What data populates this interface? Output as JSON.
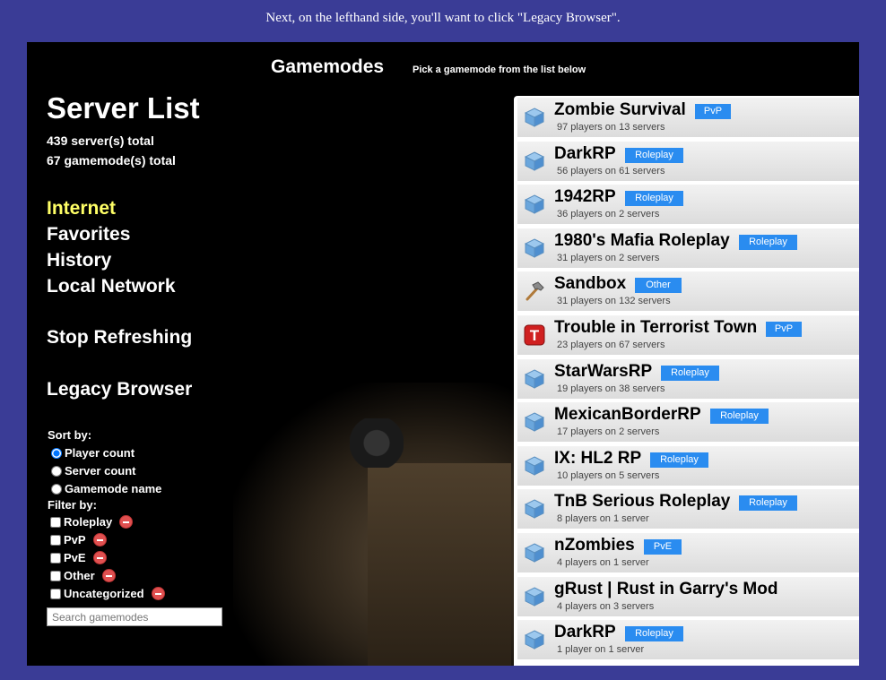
{
  "caption": "Next, on the lefthand side, you'll want to click \"Legacy Browser\".",
  "header": {
    "title": "Gamemodes",
    "subtitle": "Pick a gamemode from the list below"
  },
  "sidebar": {
    "title": "Server List",
    "servers_total": "439 server(s) total",
    "gamemodes_total": "67 gamemode(s) total",
    "nav": [
      "Internet",
      "Favorites",
      "History",
      "Local Network"
    ],
    "stop_refreshing": "Stop Refreshing",
    "legacy_browser": "Legacy Browser",
    "sort_label": "Sort by:",
    "sort_options": [
      "Player count",
      "Server count",
      "Gamemode name"
    ],
    "filter_label": "Filter by:",
    "filters": [
      "Roleplay",
      "PvP",
      "PvE",
      "Other",
      "Uncategorized"
    ],
    "search_placeholder": "Search gamemodes"
  },
  "gamemodes": [
    {
      "name": "Zombie Survival",
      "tag": "PvP",
      "stats": "97 players on 13 servers",
      "icon": "cube-icon"
    },
    {
      "name": "DarkRP",
      "tag": "Roleplay",
      "stats": "56 players on 61 servers",
      "icon": "cube-icon"
    },
    {
      "name": "1942RP",
      "tag": "Roleplay",
      "stats": "36 players on 2 servers",
      "icon": "cube-icon"
    },
    {
      "name": "1980's Mafia Roleplay",
      "tag": "Roleplay",
      "stats": "31 players on 2 servers",
      "icon": "cube-icon"
    },
    {
      "name": "Sandbox",
      "tag": "Other",
      "stats": "31 players on 132 servers",
      "icon": "hammer-icon"
    },
    {
      "name": "Trouble in Terrorist Town",
      "tag": "PvP",
      "stats": "23 players on 67 servers",
      "icon": "ttt-icon"
    },
    {
      "name": "StarWarsRP",
      "tag": "Roleplay",
      "stats": "19 players on 38 servers",
      "icon": "cube-icon"
    },
    {
      "name": "MexicanBorderRP",
      "tag": "Roleplay",
      "stats": "17 players on 2 servers",
      "icon": "cube-icon"
    },
    {
      "name": "IX: HL2 RP",
      "tag": "Roleplay",
      "stats": "10 players on 5 servers",
      "icon": "cube-icon"
    },
    {
      "name": "TnB Serious Roleplay",
      "tag": "Roleplay",
      "stats": "8 players on 1 server",
      "icon": "cube-icon"
    },
    {
      "name": "nZombies",
      "tag": "PvE",
      "stats": "4 players on 1 server",
      "icon": "cube-icon"
    },
    {
      "name": "gRust | Rust in Garry's Mod",
      "tag": "",
      "stats": "4 players on 3 servers",
      "icon": "cube-icon"
    },
    {
      "name": "DarkRP",
      "tag": "Roleplay",
      "stats": "1 player on 1 server",
      "icon": "cube-icon"
    }
  ],
  "colors": {
    "page_bg": "#3a3c96",
    "active_nav": "#ffff66",
    "tag_bg": "#2a8cf0"
  }
}
